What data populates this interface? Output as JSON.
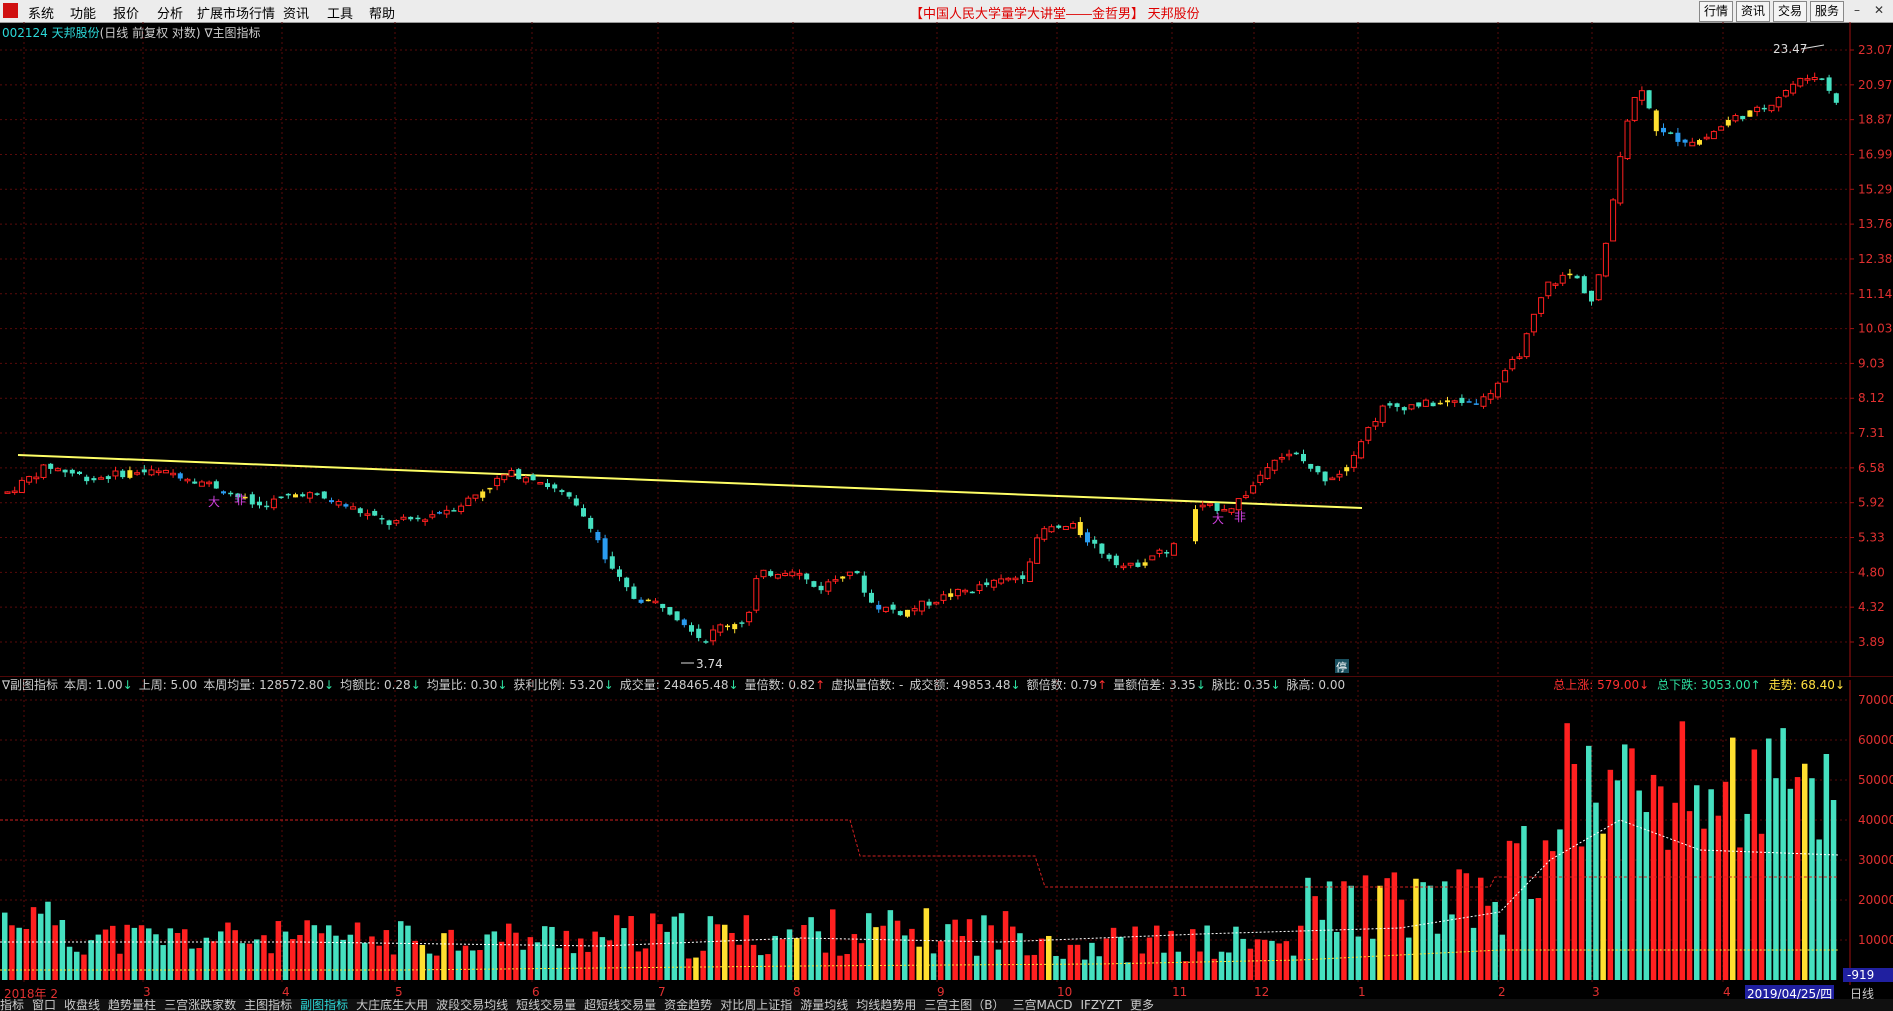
{
  "menu": {
    "items": [
      "系统",
      "功能",
      "报价",
      "分析",
      "扩展市场行情",
      "资讯",
      "工具",
      "帮助"
    ],
    "center_title": "【中国人民大学量学大讲堂——金哲男】 天邦股份",
    "right_buttons": [
      "行情",
      "资讯",
      "交易",
      "服务"
    ]
  },
  "stock": {
    "code_name": "002124 天邦股份",
    "mode": "(日线 前复权 对数)",
    "indicator_toggle": "∇主图指标"
  },
  "main_axis": {
    "ticks": [
      "23.07",
      "20.97",
      "18.87",
      "16.99",
      "15.29",
      "13.76",
      "12.38",
      "11.14",
      "10.03",
      "9.03",
      "8.12",
      "7.31",
      "6.58",
      "5.92",
      "5.33",
      "4.80",
      "4.32",
      "3.89"
    ],
    "high_label": "23.47",
    "low_label": "3.74",
    "annotations": [
      "大",
      "非",
      "大",
      "非",
      "停"
    ]
  },
  "sub_header": {
    "items": [
      {
        "label": "∇副图指标",
        "value": "",
        "dir": ""
      },
      {
        "label": "本周:",
        "value": "1.00",
        "dir": "dn"
      },
      {
        "label": "上周:",
        "value": "5.00",
        "dir": ""
      },
      {
        "label": "本周均量:",
        "value": "128572.80",
        "dir": "dn"
      },
      {
        "label": "均额比:",
        "value": "0.28",
        "dir": "dn"
      },
      {
        "label": "均量比:",
        "value": "0.30",
        "dir": "dn"
      },
      {
        "label": "获利比例:",
        "value": "53.20",
        "dir": "dn"
      },
      {
        "label": "成交量:",
        "value": "248465.48",
        "dir": "dn"
      },
      {
        "label": "量倍数:",
        "value": "0.82",
        "dir": "up"
      },
      {
        "label": "虚拟量倍数:",
        "value": "-",
        "dir": ""
      },
      {
        "label": "成交额:",
        "value": "49853.48",
        "dir": "dn"
      },
      {
        "label": "额倍数:",
        "value": "0.79",
        "dir": "up"
      },
      {
        "label": "量额倍差:",
        "value": "3.35",
        "dir": "dn"
      },
      {
        "label": "脉比:",
        "value": "0.35",
        "dir": "dn"
      },
      {
        "label": "脉高:",
        "value": "0.00",
        "dir": ""
      }
    ],
    "right": [
      {
        "label": "总上涨:",
        "value": "579.00",
        "color": "#ff3030",
        "dir": "dn"
      },
      {
        "label": "总下跌:",
        "value": "3053.00",
        "color": "#2ee0a0",
        "dir": "up"
      },
      {
        "label": "走势:",
        "value": "68.40",
        "color": "#ffe040",
        "dir": "dn"
      }
    ]
  },
  "sub_axis": {
    "ticks": [
      "70000",
      "60000",
      "50000",
      "40000",
      "30000",
      "20000",
      "10000"
    ],
    "bottom_value": "-919"
  },
  "date_axis": {
    "labels": [
      "2018年 2",
      "3",
      "4",
      "5",
      "6",
      "7",
      "8",
      "9",
      "10",
      "11",
      "12",
      "1",
      "2",
      "3",
      "4"
    ],
    "current_date": "2019/04/25/四",
    "period": "日线"
  },
  "bottom_tabs": [
    "指标",
    "窗口",
    "收盘线",
    "趋势量柱",
    "三宫涨跌家数",
    "主图指标",
    "副图指标",
    "大庄底生大用",
    "波段交易均线",
    "短线交易量",
    "超短线交易量",
    "资金趋势",
    "对比周上证指",
    "游量均线",
    "均线趋势用",
    "三宫主图（B）",
    "三宫MACD",
    "IFZYZT",
    "更多"
  ],
  "active_tab": "副图指标",
  "colors": {
    "up": "#ff2020",
    "down": "#45e0c0",
    "yellow": "#ffe030",
    "blue": "#2a9cf0",
    "trend": "#ffff66"
  }
}
